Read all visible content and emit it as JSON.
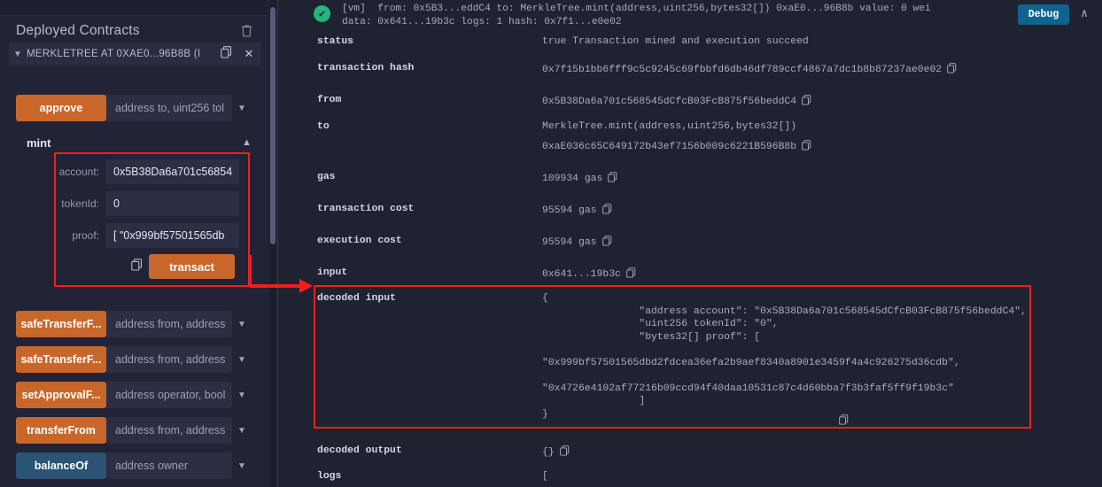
{
  "sidebar": {
    "panel_title": "Deployed Contracts",
    "trash_icon": "trash-icon",
    "contract": {
      "caret": "▼",
      "label": "MERKLETREE AT 0XAE0...96B8B (I",
      "copy_icon": "copy-icon",
      "close_icon": "✕"
    },
    "functions": [
      {
        "name": "approve",
        "style": "orange",
        "placeholder": "address to, uint256 tol",
        "caret": "▼"
      },
      {
        "name": "safeTransferF...",
        "style": "orange",
        "placeholder": "address from, address",
        "caret": "▼"
      },
      {
        "name": "safeTransferF...",
        "style": "orange",
        "placeholder": "address from, address",
        "caret": "▼"
      },
      {
        "name": "setApprovalF...",
        "style": "orange",
        "placeholder": "address operator, bool",
        "caret": "▼"
      },
      {
        "name": "transferFrom",
        "style": "orange",
        "placeholder": "address from, address",
        "caret": "▼"
      },
      {
        "name": "balanceOf",
        "style": "blue",
        "placeholder": "address owner",
        "caret": "▼"
      }
    ],
    "mint": {
      "label": "mint",
      "caret": "▲",
      "params": [
        {
          "label": "account:",
          "value": "0x5B38Da6a701c56854"
        },
        {
          "label": "tokenId:",
          "value": "0"
        },
        {
          "label": "proof:",
          "value": "[  \"0x999bf57501565db"
        }
      ],
      "copy_icon": "copy-icon",
      "transact_label": "transact"
    }
  },
  "terminal": {
    "status_icon": "success-check-icon",
    "header_line1_prefix": "[vm]",
    "header_line1": "[vm]  from: 0x5B3...eddC4 to: MerkleTree.mint(address,uint256,bytes32[]) 0xaE0...96B8b value: 0 wei",
    "header_line2": "data: 0x641...19b3c logs: 1 hash: 0x7f1...e0e02",
    "debug_label": "Debug",
    "collapse_caret": "∧",
    "rows": [
      {
        "key": "status",
        "value": "true Transaction mined and execution succeed",
        "copy": false
      },
      {
        "key": "transaction hash",
        "value": "0x7f15b1bb6fff9c5c9245c69fbbfd6db46df789ccf4867a7dc1b8b87237ae0e02",
        "copy": true
      },
      {
        "key": "from",
        "value": "0x5B38Da6a701c568545dCfcB03FcB875f56beddC4",
        "copy": true
      },
      {
        "key": "to",
        "value": "MerkleTree.mint(address,uint256,bytes32[])",
        "copy": false
      },
      {
        "key": "",
        "value": "0xaE036c65C649172b43ef7156b009c6221B596B8b",
        "copy": true
      },
      {
        "key": "gas",
        "value": "109934 gas",
        "copy": true
      },
      {
        "key": "transaction cost",
        "value": "95594 gas",
        "copy": true
      },
      {
        "key": "execution cost",
        "value": "95594 gas",
        "copy": true
      },
      {
        "key": "input",
        "value": "0x641...19b3c",
        "copy": true
      }
    ],
    "decoded_input": {
      "key": "decoded input",
      "json": "{\n\t\t\"address account\": \"0x5B38Da6a701c568545dCfcB03FcB875f56beddC4\",\n\t\t\"uint256 tokenId\": \"0\",\n\t\t\"bytes32[] proof\": [\n\n\"0x999bf57501565dbd2fdcea36efa2b9aef8340a8901e3459f4a4c926275d36cdb\",\n\n\"0x4726e4102af77216b09ccd94f40daa10531c87c4d60bba7f3b3faf5ff9f19b3c\"\n\t\t]\n}",
      "copy_icon": "copy-icon"
    },
    "decoded_output": {
      "key": "decoded output",
      "value": "{}",
      "copy": true
    },
    "logs": {
      "key": "logs",
      "value": "["
    }
  },
  "annotation": {
    "arrow_color": "#f21e1e",
    "highlight_color": "#f21e1e"
  },
  "colors": {
    "orange": "#c9672a",
    "blue": "#2a5374",
    "debug_blue": "#11638f",
    "success_green": "#24b47e",
    "panel_bg": "#222336",
    "terminal_bg": "#1f2231"
  }
}
